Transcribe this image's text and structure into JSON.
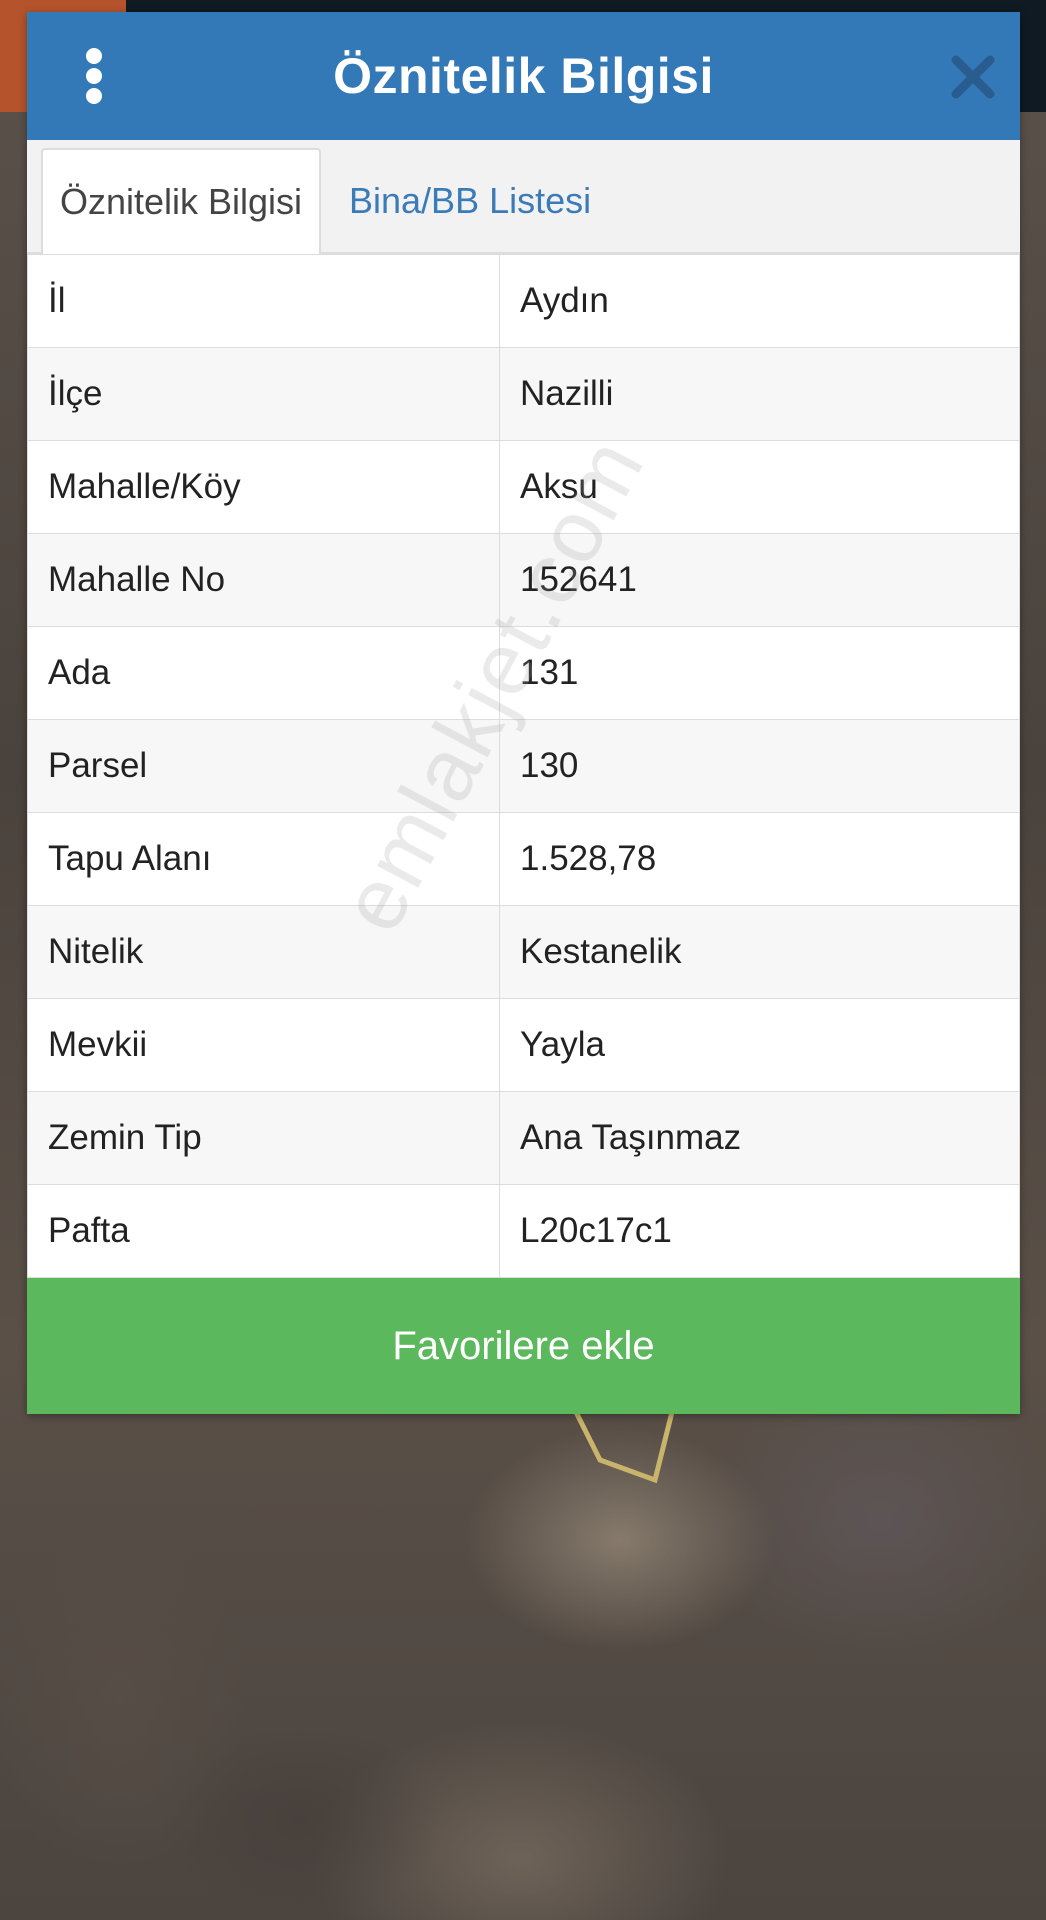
{
  "dialog": {
    "title": "Öznitelik Bilgisi",
    "menu_icon": "more-vertical-icon",
    "close_icon": "close-icon"
  },
  "tabs": [
    {
      "label": "Öznitelik Bilgisi",
      "active": true
    },
    {
      "label": "Bina/BB Listesi",
      "active": false
    }
  ],
  "attributes": [
    {
      "label": "İl",
      "value": "Aydın"
    },
    {
      "label": "İlçe",
      "value": "Nazilli"
    },
    {
      "label": "Mahalle/Köy",
      "value": "Aksu"
    },
    {
      "label": "Mahalle No",
      "value": "152641"
    },
    {
      "label": "Ada",
      "value": "131"
    },
    {
      "label": "Parsel",
      "value": "130"
    },
    {
      "label": "Tapu Alanı",
      "value": "1.528,78"
    },
    {
      "label": "Nitelik",
      "value": "Kestanelik"
    },
    {
      "label": "Mevkii",
      "value": "Yayla"
    },
    {
      "label": "Zemin Tip",
      "value": "Ana Taşınmaz"
    },
    {
      "label": "Pafta",
      "value": "L20c17c1"
    }
  ],
  "favorite_button": {
    "label": "Favorilere ekle"
  },
  "watermark": "emlakjet.com",
  "colors": {
    "header": "#3479b7",
    "tab_link": "#3a7bb8",
    "favorite_button": "#5cb85c"
  }
}
